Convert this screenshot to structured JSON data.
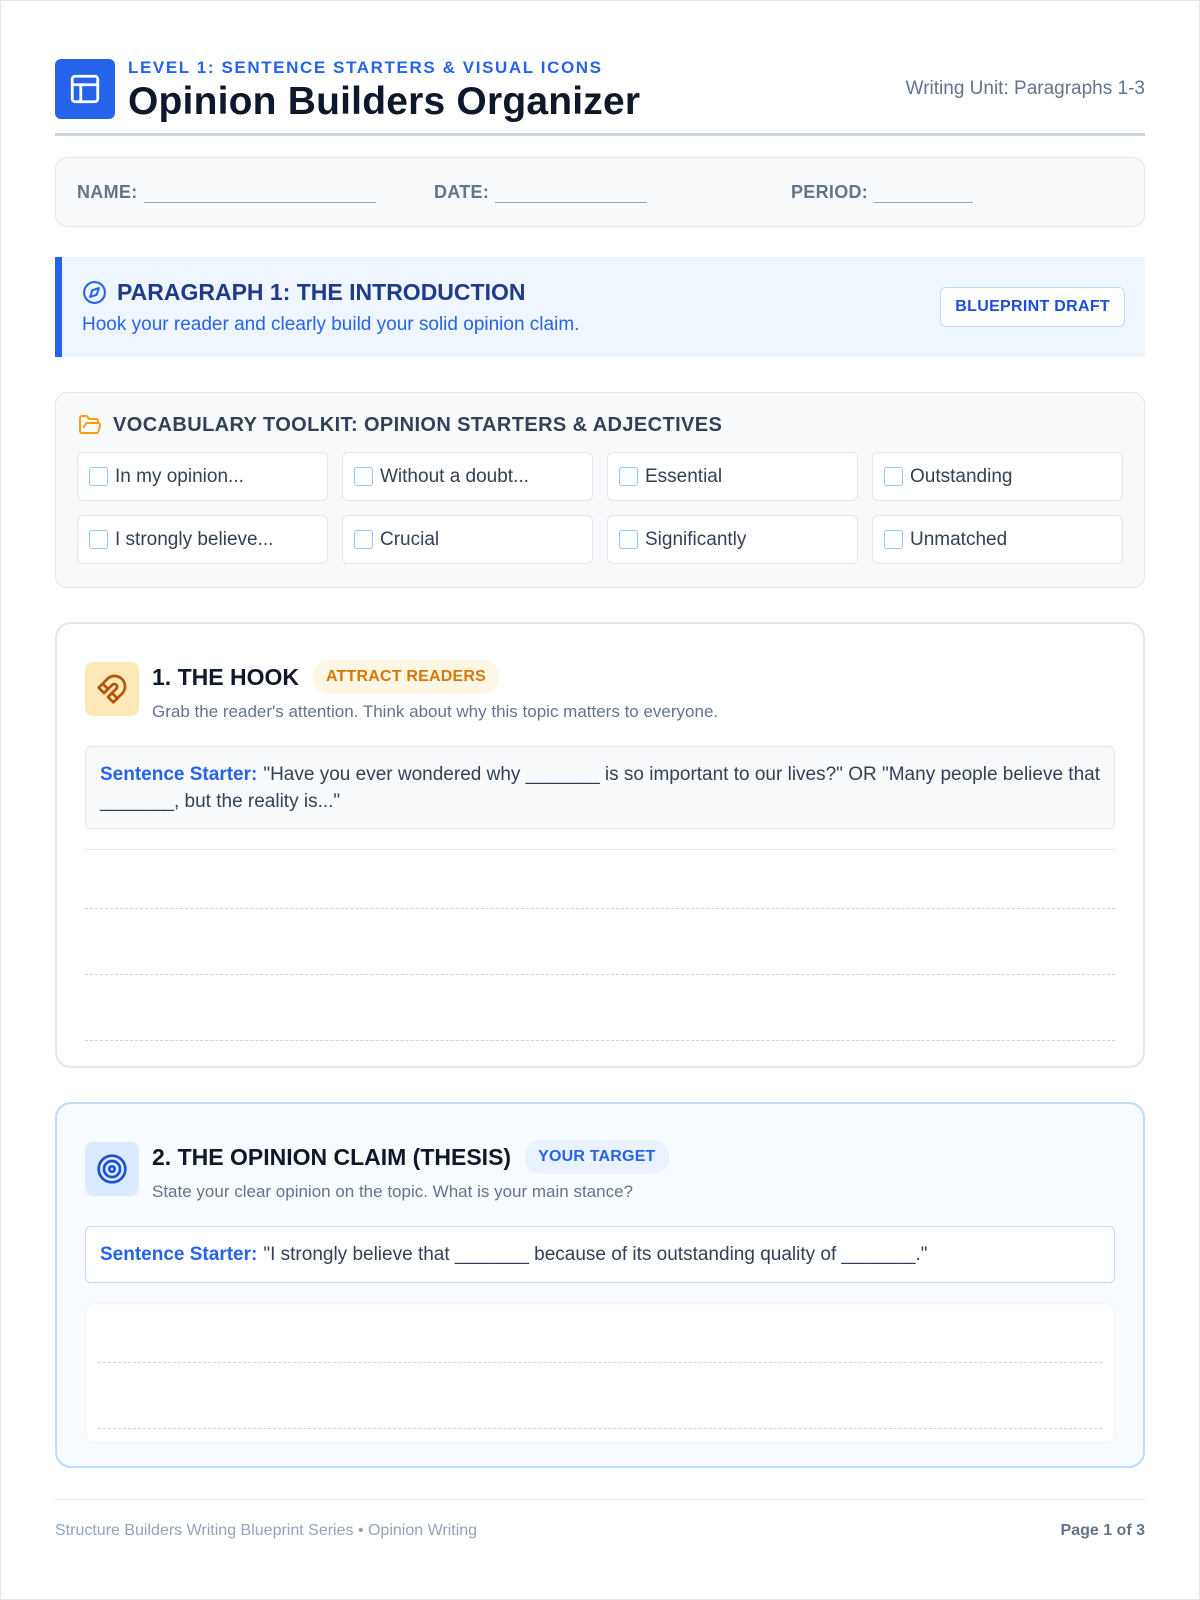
{
  "header": {
    "level": "LEVEL 1: SENTENCE STARTERS & VISUAL ICONS",
    "title": "Opinion Builders Organizer",
    "unit": "Writing Unit: Paragraphs 1-3",
    "icon": "layout-icon"
  },
  "student_info": {
    "name_label": "NAME:",
    "date_label": "DATE:",
    "period_label": "PERIOD:"
  },
  "paragraph": {
    "title": "PARAGRAPH 1: THE INTRODUCTION",
    "subtitle": "Hook your reader and clearly build your solid opinion claim.",
    "badge": "BLUEPRINT DRAFT",
    "icon": "compass-icon"
  },
  "toolkit": {
    "title": "VOCABULARY TOOLKIT: OPINION STARTERS & ADJECTIVES",
    "icon": "folder-open-icon",
    "items": [
      "In my opinion...",
      "Without a doubt...",
      "Essential",
      "Outstanding",
      "I strongly believe...",
      "Crucial",
      "Significantly",
      "Unmatched"
    ]
  },
  "sections": {
    "hook": {
      "title": "1. THE HOOK",
      "tag": "ATTRACT READERS",
      "description": "Grab the reader's attention. Think about why this topic matters to everyone.",
      "starter_label": "Sentence Starter:",
      "starter_text": "\"Have you ever wondered why _______ is so important to our lives?\" OR \"Many people believe that _______, but the reality is...\"",
      "icon": "magnet-icon"
    },
    "claim": {
      "title": "2. THE OPINION CLAIM (THESIS)",
      "tag": "YOUR TARGET",
      "description": "State your clear opinion on the topic. What is your main stance?",
      "starter_label": "Sentence Starter:",
      "starter_text": "\"I strongly believe that _______ because of its outstanding quality of _______.\"",
      "icon": "target-icon"
    }
  },
  "footer": {
    "series": "Structure Builders Writing Blueprint Series • Opinion Writing",
    "page": "Page 1 of 3"
  },
  "colors": {
    "accent": "#2563eb",
    "hook_accent": "#d97706",
    "text_dark": "#0f172a"
  }
}
